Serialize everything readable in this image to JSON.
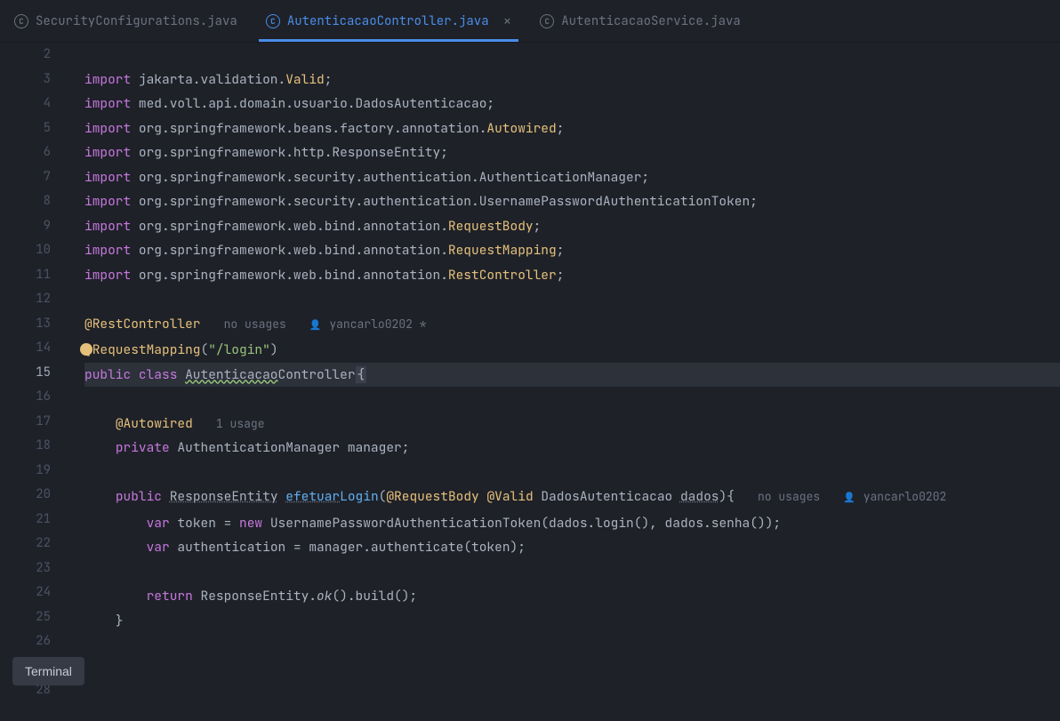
{
  "tabs": [
    {
      "label": "SecurityConfigurations.java",
      "active": false
    },
    {
      "label": "AutenticacaoController.java",
      "active": true
    },
    {
      "label": "AutenticacaoService.java",
      "active": false
    }
  ],
  "gutter": {
    "start": 2,
    "end": 28,
    "active_line": 15
  },
  "hints": {
    "no_usages": "no usages",
    "one_usage": "1 usage",
    "author": "yancarlo0202",
    "author_star": "yancarlo0202 *"
  },
  "code": {
    "l3": {
      "kw": "import",
      "pkg": " jakarta.validation.",
      "cls": "Valid",
      "end": ";"
    },
    "l4": {
      "kw": "import",
      "pkg": " med.voll.api.domain.usuario.DadosAutenticacao;",
      "cls": "",
      "end": ""
    },
    "l5": {
      "kw": "import",
      "pkg": " org.springframework.beans.factory.annotation.",
      "cls": "Autowired",
      "end": ";"
    },
    "l6": {
      "kw": "import",
      "pkg": " org.springframework.http.ResponseEntity;",
      "cls": "",
      "end": ""
    },
    "l7": {
      "kw": "import",
      "pkg": " org.springframework.security.authentication.AuthenticationManager;",
      "cls": "",
      "end": ""
    },
    "l8": {
      "kw": "import",
      "pkg": " org.springframework.security.authentication.UsernamePasswordAuthenticationToken;",
      "cls": "",
      "end": ""
    },
    "l9": {
      "kw": "import",
      "pkg": " org.springframework.web.bind.annotation.",
      "cls": "RequestBody",
      "end": ";"
    },
    "l10": {
      "kw": "import",
      "pkg": " org.springframework.web.bind.annotation.",
      "cls": "RequestMapping",
      "end": ";"
    },
    "l11": {
      "kw": "import",
      "pkg": " org.springframework.web.bind.annotation.",
      "cls": "RestController",
      "end": ";"
    },
    "l13": {
      "ann": "@RestController"
    },
    "l14": {
      "ann": "@RequestMapping",
      "open": "(",
      "str": "\"/login\"",
      "close": ")"
    },
    "l15": {
      "kw1": "public",
      "kw2": "class",
      "cls": "Autenticacao",
      "cls2": "Controller",
      "brace": "{"
    },
    "l17": {
      "ann": "@Autowired"
    },
    "l18": {
      "kw": "private",
      "type": " AuthenticationManager ",
      "var": "manager",
      "end": ";"
    },
    "l20": {
      "kw": "public",
      "type": "ResponseEntity",
      "method": "efetuar",
      "method2": "Login",
      "open": "(",
      "ann1": "@RequestBody",
      "ann2": "@Valid",
      "ptype": " DadosAutenticacao ",
      "pvar": "dados",
      "close": "){"
    },
    "l21": {
      "kw": "var",
      "var": " token ",
      "eq": "= ",
      "new": "new",
      "type": " UsernamePasswordAuthenticationToken",
      "args": "(dados.login(), dados.senha());"
    },
    "l22": {
      "kw": "var",
      "var": " authentication ",
      "eq": "= ",
      "obj": "manager",
      "call": ".authenticate(token);"
    },
    "l24": {
      "kw": "return",
      "body": " ResponseEntity.",
      "ok": "ok",
      "end": "().build();"
    },
    "l25": {
      "brace": "}"
    }
  },
  "tooltip": {
    "terminal": "Terminal"
  }
}
